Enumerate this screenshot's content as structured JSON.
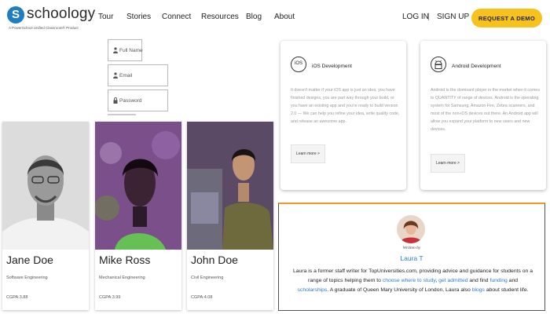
{
  "header": {
    "logo_text": "schoology",
    "logo_letter": "S",
    "logo_tagline": "A PowerSchool Unified Classroom® Product",
    "nav": [
      "Tour",
      "Stories",
      "Connect",
      "Resources",
      "Blog",
      "About"
    ],
    "login_label": "LOG IN",
    "separator": "|",
    "signup_label": "SIGN UP",
    "demo_label": "REQUEST A DEMO",
    "accent_color": "#f6c21b",
    "logo_color": "#1f7ec1"
  },
  "form": {
    "full_name_placeholder": "Full Name",
    "email_placeholder": "Email",
    "password_placeholder": "Password"
  },
  "profiles": [
    {
      "name": "Jane Doe",
      "major": "Software Engineering",
      "cgpa": "CGPA:3.88"
    },
    {
      "name": "Mike Ross",
      "major": "Mechanical Engineering",
      "cgpa": "CGPA:3.99"
    },
    {
      "name": "John Doe",
      "major": "Civil Engineering",
      "cgpa": "CGPA:4.08"
    }
  ],
  "dev_cards": [
    {
      "icon_label": "iOS",
      "title": "iOS Development",
      "body": "It doesn't matter if your iOS app is just an idea, you have finished designs, you are part way through your build, or you have an existing app and you're ready to build version 2.0 — We can help you refine your idea, write quality code, and release an awesome app.",
      "button": "Learn more >"
    },
    {
      "icon_label": "android-icon",
      "title": "Android Development",
      "body": "Android is the dominant player in the market when it comes to QUANTITY of range of devices. Android is the operating system for Samsung, Amazon Fire, Zebra scanners, and most of the non-iOS devices out there. An Android app will allow you expand your platform to new users and new devices.",
      "button": "Learn more >"
    }
  ],
  "author": {
    "written_by": "Written by",
    "name": "Laura T",
    "bio_1": "Laura is a former staff writer for TopUniversities.com, providing advice and guidance for students on a range of topics helping them to ",
    "link_1": "choose where to study",
    "bio_2": ", ",
    "link_2": "get admitted",
    "bio_3": " and find ",
    "link_3": "funding",
    "bio_4": " and ",
    "link_4": "scholarships",
    "bio_5": ". A graduate of Queen Mary University of London, Laura also ",
    "link_5": "blogs",
    "bio_6": " about student life.",
    "border_color": "#ee9b2b",
    "link_color": "#2c7bd2"
  }
}
